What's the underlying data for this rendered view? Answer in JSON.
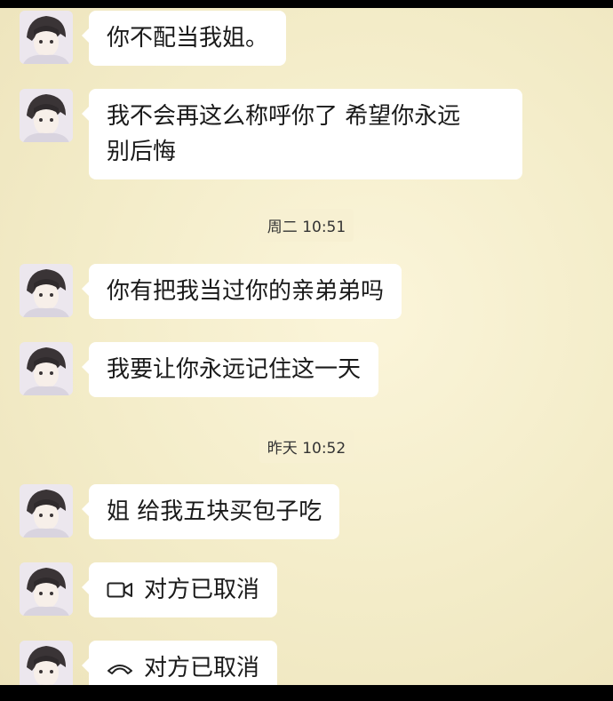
{
  "messages": [
    {
      "text": "你不配当我姐。"
    },
    {
      "text": "我不会再这么称呼你了 希望你永远\n别后悔"
    },
    {
      "time": "周二 10:51"
    },
    {
      "text": "你有把我当过你的亲弟弟吗"
    },
    {
      "text": "我要让你永远记住这一天"
    },
    {
      "time": "昨天 10:52"
    },
    {
      "text": "姐 给我五块买包子吃"
    },
    {
      "call_icon": "video-call-icon",
      "text": "对方已取消"
    },
    {
      "call_icon": "phone-hangup-icon",
      "text": "对方已取消"
    }
  ],
  "colors": {
    "background": "#f3ecc8",
    "bubble": "#ffffff",
    "timestamp_bg": "#f7f0d2",
    "text": "#1a1a1a",
    "top_bottom_bar": "#000000"
  }
}
